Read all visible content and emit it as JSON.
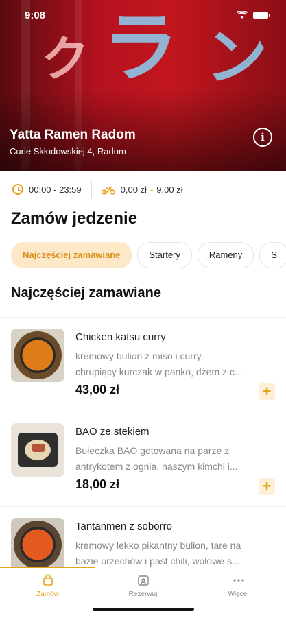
{
  "status_bar": {
    "time": "9:08"
  },
  "restaurant": {
    "name": "Yatta Ramen Radom",
    "address": "Curie Skłodowskiej 4, Radom"
  },
  "info": {
    "hours": "00:00 - 23:59",
    "delivery_from": "0,00 zł",
    "delivery_to": "9,00 zł"
  },
  "order": {
    "title": "Zamów jedzenie"
  },
  "categories": [
    "Najczęściej zamawiane",
    "Startery",
    "Rameny",
    "S"
  ],
  "section": {
    "title": "Najczęściej zamawiane"
  },
  "items": [
    {
      "name": "Chicken katsu curry",
      "desc_line1": "kremowy bulion z miso i curry,",
      "desc_line2": "chrupiący kurczak w panko, dżem z c...",
      "price": "43,00 zł"
    },
    {
      "name": "BAO ze stekiem",
      "desc_line1": "Bułeczka BAO gotowana na parze z",
      "desc_line2": "antrykotem z ognia, naszym kimchi i...",
      "price": "18,00 zł"
    },
    {
      "name": "Tantanmen z soborro",
      "desc_line1": "kremowy lekko pikantny bulion, tare na",
      "desc_line2": "bazie orzechów i past chili, wołowe s...",
      "price": ""
    }
  ],
  "tabbar": {
    "order": "Zamów",
    "reserve": "Rezerwuj",
    "more": "Więcej"
  },
  "colors": {
    "accent": "#e6a21a",
    "accent_bg": "#fde9c8",
    "hero_red": "#c2161f"
  }
}
